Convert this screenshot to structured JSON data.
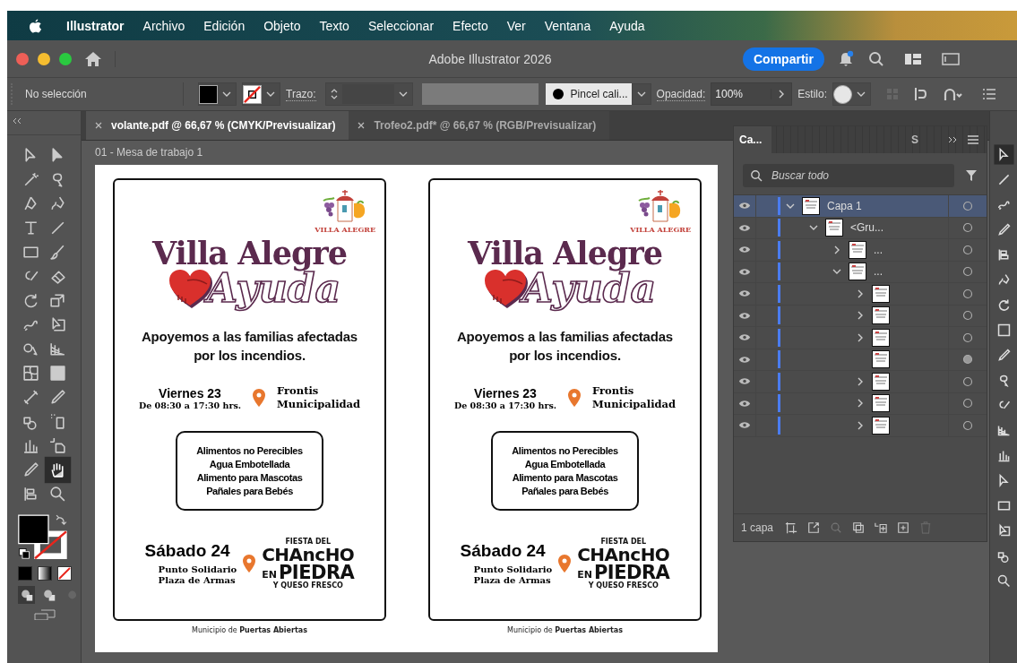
{
  "menu_bar": {
    "app_name": "Illustrator",
    "items": [
      "Archivo",
      "Edición",
      "Objeto",
      "Texto",
      "Seleccionar",
      "Efecto",
      "Ver",
      "Ventana",
      "Ayuda"
    ]
  },
  "window": {
    "title": "Adobe Illustrator 2026",
    "share_button": "Compartir",
    "notification": true
  },
  "control_bar": {
    "selection": "No selección",
    "stroke_label": "Trazo:",
    "brush": "Pincel cali...",
    "opacity_label": "Opacidad:",
    "opacity": "100%",
    "style_label": "Estilo:"
  },
  "tools": [
    {
      "selected": false
    },
    {
      "selected": false
    },
    {
      "selected": false
    },
    {
      "selected": false
    },
    {
      "selected": false
    },
    {
      "selected": false
    },
    {
      "selected": false
    },
    {
      "selected": false
    },
    {
      "selected": false
    },
    {
      "selected": false
    },
    {
      "selected": false
    },
    {
      "selected": false
    },
    {
      "selected": false
    },
    {
      "selected": false
    },
    {
      "selected": false
    },
    {
      "selected": false
    },
    {
      "selected": false
    },
    {
      "selected": false
    },
    {
      "selected": false
    },
    {
      "selected": false
    },
    {
      "selected": false
    },
    {
      "selected": false
    },
    {
      "selected": false
    },
    {
      "selected": false
    },
    {
      "selected": false
    },
    {
      "selected": false
    },
    {
      "selected": false
    },
    {
      "selected": true
    },
    {
      "selected": false
    },
    {
      "selected": false
    }
  ],
  "document_tabs": [
    {
      "label": "volante.pdf @ 66,67 % (CMYK/Previsualizar)",
      "selected": true
    },
    {
      "label": "Trofeo2.pdf* @ 66,67 % (RGB/Previsualizar)",
      "selected": false
    }
  ],
  "artboard": {
    "label": "01 - Mesa de trabajo 1",
    "flyers": [
      {
        "logo_text": "VILLA ALEGRE",
        "title": "Villa Alegre",
        "subtitle": "Ayuda",
        "tagline": [
          "Apoyemos a las familias afectadas",
          "por los incendios."
        ],
        "event_1": {
          "day": "Viernes 23",
          "hours": "De 08:30 a 17:30 hrs.",
          "place": [
            "Frontis",
            "Municipalidad"
          ]
        },
        "supplies": [
          "Alimentos no Perecibles",
          "Agua Embotellada",
          "Alimento para Mascotas",
          "Pañales para Bebés"
        ],
        "event_2": {
          "day": "Sábado 24",
          "place": [
            "Punto Solidario",
            "Plaza de Armas"
          ]
        },
        "festival_logo": {
          "top": "FIESTA DEL",
          "name": "CHAncHO",
          "prefix": "EN",
          "name_2": "PIEDRA",
          "bottom": "Y QUESO FRESCO"
        },
        "footer": "Municipio de **Puertas Abiertas**"
      },
      {
        "logo_text": "VILLA ALEGRE",
        "title": "Villa Alegre",
        "subtitle": "Ayuda",
        "tagline": [
          "Apoyemos a las familias afectadas",
          "por los incendios."
        ],
        "event_1": {
          "day": "Viernes 23",
          "hours": "De 08:30 a 17:30 hrs.",
          "place": [
            "Frontis",
            "Municipalidad"
          ]
        },
        "supplies": [
          "Alimentos no Perecibles",
          "Agua Embotellada",
          "Alimento para Mascotas",
          "Pañales para Bebés"
        ],
        "event_2": {
          "day": "Sábado 24",
          "place": [
            "Punto Solidario",
            "Plaza de Armas"
          ]
        },
        "festival_logo": {
          "top": "FIESTA DEL",
          "name": "CHAncHO",
          "prefix": "EN",
          "name_2": "PIEDRA",
          "bottom": "Y QUESO FRESCO"
        },
        "footer": "Municipio de **Puertas Abiertas**"
      }
    ]
  },
  "layers_panel": {
    "tabs": [
      {
        "label": "Ca...",
        "selected": true
      },
      {
        "label": "S",
        "selected": false
      }
    ],
    "search": {
      "placeholder": "Buscar todo"
    },
    "layers": [
      {
        "name": "Capa 1",
        "kind": "group",
        "expanded": true,
        "selected": true,
        "visible": true,
        "targeted": false,
        "children": [
          {
            "name": "<Gru...",
            "kind": "group",
            "expanded": true,
            "selected": false,
            "visible": true,
            "targeted": false,
            "children": [
              {
                "name": "...",
                "kind": "group",
                "expanded": false,
                "selected": false,
                "visible": true,
                "targeted": false
              },
              {
                "name": "...",
                "kind": "group",
                "expanded": true,
                "selected": false,
                "visible": true,
                "targeted": false,
                "children": [
                  {
                    "kind": "group",
                    "expanded": false,
                    "selected": false,
                    "visible": true,
                    "targeted": false
                  },
                  {
                    "kind": "group",
                    "expanded": false,
                    "selected": false,
                    "visible": true,
                    "targeted": false
                  },
                  {
                    "kind": "group",
                    "expanded": false,
                    "selected": false,
                    "visible": true,
                    "targeted": false
                  },
                  {
                    "kind": "object",
                    "selected": false,
                    "visible": true,
                    "targeted": true
                  },
                  {
                    "kind": "group",
                    "expanded": false,
                    "selected": false,
                    "visible": true,
                    "targeted": false
                  },
                  {
                    "kind": "group",
                    "expanded": false,
                    "selected": false,
                    "visible": true,
                    "targeted": false
                  },
                  {
                    "kind": "group",
                    "expanded": false,
                    "selected": false,
                    "visible": true,
                    "targeted": false
                  }
                ]
              }
            ]
          }
        ]
      }
    ],
    "footer": "1 capa"
  }
}
